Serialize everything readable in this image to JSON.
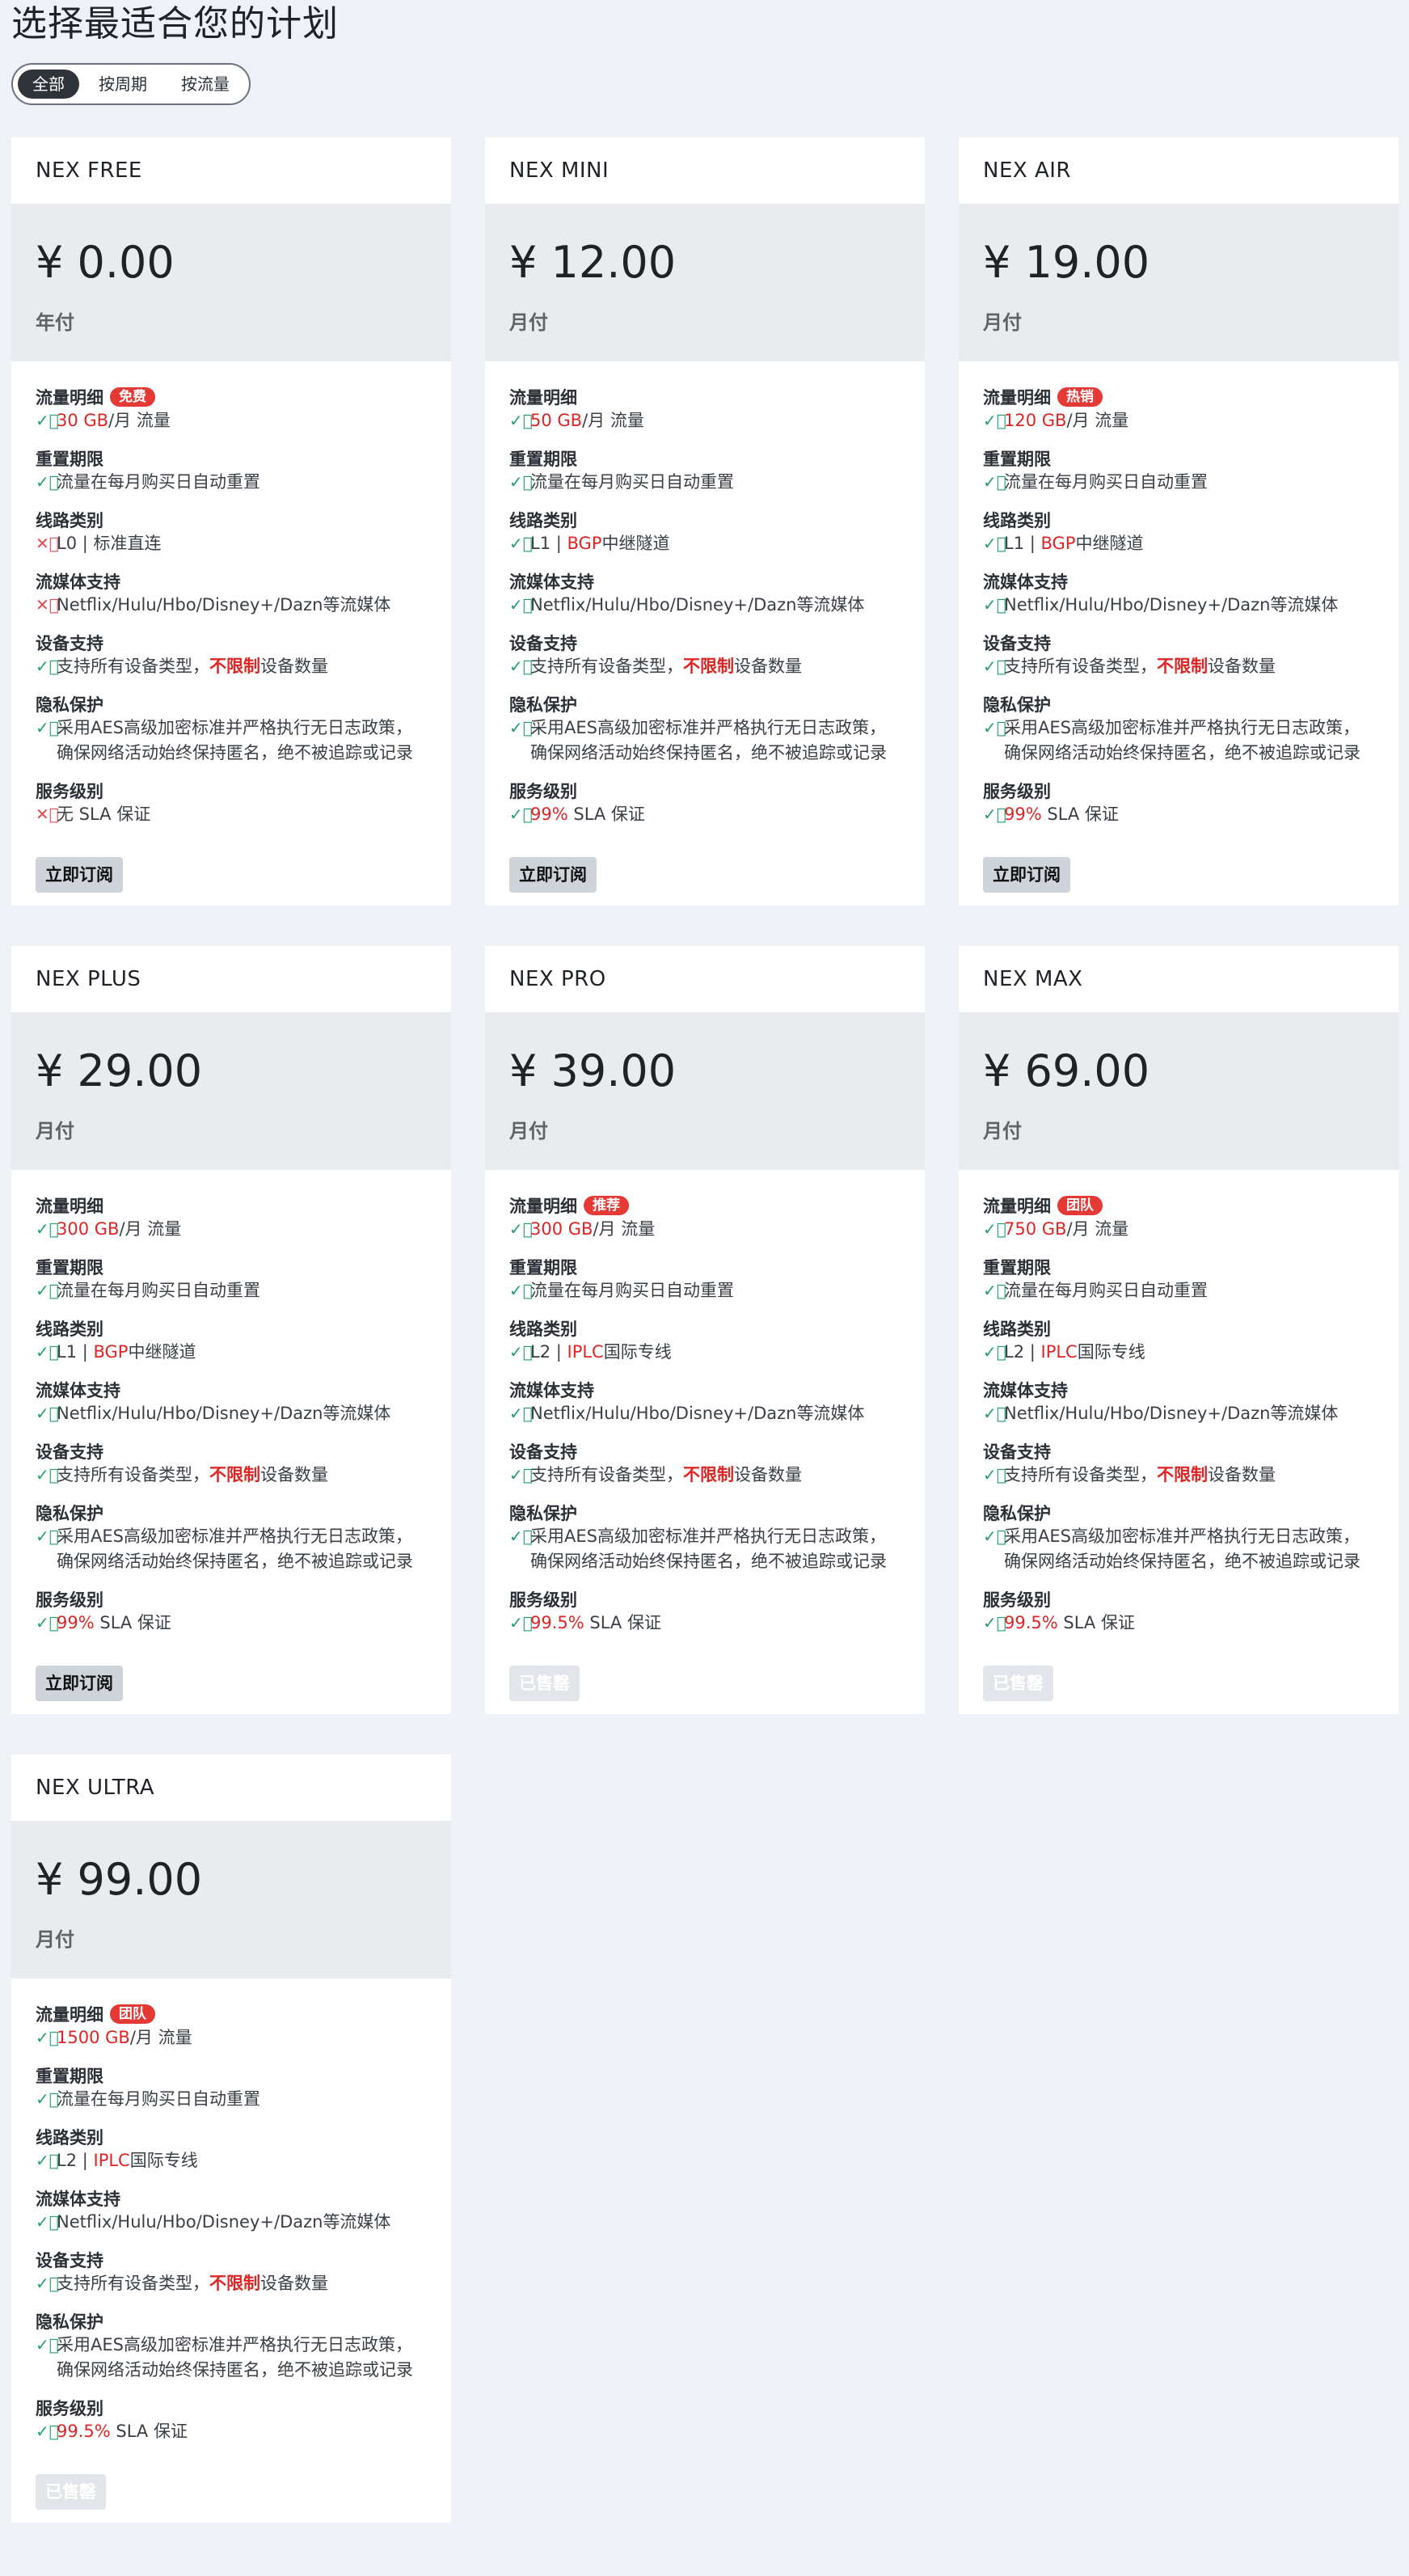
{
  "page": {
    "title": "选择最适合您的计划",
    "filters": [
      {
        "label": "全部",
        "active": true
      },
      {
        "label": "按周期",
        "active": false
      },
      {
        "label": "按流量",
        "active": false
      }
    ]
  },
  "labels": {
    "traffic": "流量明细",
    "reset": "重置期限",
    "route": "线路类别",
    "stream": "流媒体支持",
    "device": "设备支持",
    "privacy": "隐私保护",
    "sla": "服务级别"
  },
  "plans": [
    {
      "name": "NEX FREE",
      "price": "¥ 0.00",
      "cycle": "年付",
      "badge": "免费",
      "traffic_value": "30 GB",
      "traffic_suffix": "/月 流量",
      "reset": "流量在每月购买日自动重置",
      "route_prefix": "L0 | ",
      "route_hl": "",
      "route_suffix": "标准直连",
      "route_ok": false,
      "stream": "Netflix/Hulu/Hbo/Disney+/Dazn等流媒体",
      "stream_ok": false,
      "device_a": "支持所有设备类型，",
      "device_b": "不限制",
      "device_c": "设备数量",
      "privacy": "采用AES高级加密标准并严格执行无日志政策，确保网络活动始终保持匿名，绝不被追踪或记录",
      "sla_value": "",
      "sla_suffix": "无 SLA 保证",
      "sla_ok": false,
      "button": "立即订阅",
      "sold": false
    },
    {
      "name": "NEX MINI",
      "price": "¥ 12.00",
      "cycle": "月付",
      "badge": "",
      "traffic_value": "50 GB",
      "traffic_suffix": "/月 流量",
      "reset": "流量在每月购买日自动重置",
      "route_prefix": "L1 | ",
      "route_hl": "BGP",
      "route_suffix": "中继隧道",
      "route_ok": true,
      "stream": "Netflix/Hulu/Hbo/Disney+/Dazn等流媒体",
      "stream_ok": true,
      "device_a": "支持所有设备类型，",
      "device_b": "不限制",
      "device_c": "设备数量",
      "privacy": "采用AES高级加密标准并严格执行无日志政策，确保网络活动始终保持匿名，绝不被追踪或记录",
      "sla_value": "99%",
      "sla_suffix": " SLA 保证",
      "sla_ok": true,
      "button": "立即订阅",
      "sold": false
    },
    {
      "name": "NEX AIR",
      "price": "¥ 19.00",
      "cycle": "月付",
      "badge": "热销",
      "traffic_value": "120 GB",
      "traffic_suffix": "/月 流量",
      "reset": "流量在每月购买日自动重置",
      "route_prefix": "L1 | ",
      "route_hl": "BGP",
      "route_suffix": "中继隧道",
      "route_ok": true,
      "stream": "Netflix/Hulu/Hbo/Disney+/Dazn等流媒体",
      "stream_ok": true,
      "device_a": "支持所有设备类型，",
      "device_b": "不限制",
      "device_c": "设备数量",
      "privacy": "采用AES高级加密标准并严格执行无日志政策，确保网络活动始终保持匿名，绝不被追踪或记录",
      "sla_value": "99%",
      "sla_suffix": " SLA 保证",
      "sla_ok": true,
      "button": "立即订阅",
      "sold": false
    },
    {
      "name": "NEX PLUS",
      "price": "¥ 29.00",
      "cycle": "月付",
      "badge": "",
      "traffic_value": "300 GB",
      "traffic_suffix": "/月 流量",
      "reset": "流量在每月购买日自动重置",
      "route_prefix": "L1 | ",
      "route_hl": "BGP",
      "route_suffix": "中继隧道",
      "route_ok": true,
      "stream": "Netflix/Hulu/Hbo/Disney+/Dazn等流媒体",
      "stream_ok": true,
      "device_a": "支持所有设备类型，",
      "device_b": "不限制",
      "device_c": "设备数量",
      "privacy": "采用AES高级加密标准并严格执行无日志政策，确保网络活动始终保持匿名，绝不被追踪或记录",
      "sla_value": "99%",
      "sla_suffix": " SLA 保证",
      "sla_ok": true,
      "button": "立即订阅",
      "sold": false
    },
    {
      "name": "NEX PRO",
      "price": "¥ 39.00",
      "cycle": "月付",
      "badge": "推荐",
      "traffic_value": "300 GB",
      "traffic_suffix": "/月 流量",
      "reset": "流量在每月购买日自动重置",
      "route_prefix": "L2 | ",
      "route_hl": "IPLC",
      "route_suffix": "国际专线",
      "route_ok": true,
      "stream": "Netflix/Hulu/Hbo/Disney+/Dazn等流媒体",
      "stream_ok": true,
      "device_a": "支持所有设备类型，",
      "device_b": "不限制",
      "device_c": "设备数量",
      "privacy": "采用AES高级加密标准并严格执行无日志政策，确保网络活动始终保持匿名，绝不被追踪或记录",
      "sla_value": "99.5%",
      "sla_suffix": " SLA 保证",
      "sla_ok": true,
      "button": "已售罄",
      "sold": true
    },
    {
      "name": "NEX MAX",
      "price": "¥ 69.00",
      "cycle": "月付",
      "badge": "团队",
      "traffic_value": "750 GB",
      "traffic_suffix": "/月 流量",
      "reset": "流量在每月购买日自动重置",
      "route_prefix": "L2 | ",
      "route_hl": "IPLC",
      "route_suffix": "国际专线",
      "route_ok": true,
      "stream": "Netflix/Hulu/Hbo/Disney+/Dazn等流媒体",
      "stream_ok": true,
      "device_a": "支持所有设备类型，",
      "device_b": "不限制",
      "device_c": "设备数量",
      "privacy": "采用AES高级加密标准并严格执行无日志政策，确保网络活动始终保持匿名，绝不被追踪或记录",
      "sla_value": "99.5%",
      "sla_suffix": " SLA 保证",
      "sla_ok": true,
      "button": "已售罄",
      "sold": true
    },
    {
      "name": "NEX ULTRA",
      "price": "¥ 99.00",
      "cycle": "月付",
      "badge": "团队",
      "traffic_value": "1500 GB",
      "traffic_suffix": "/月 流量",
      "reset": "流量在每月购买日自动重置",
      "route_prefix": "L2 | ",
      "route_hl": "IPLC",
      "route_suffix": "国际专线",
      "route_ok": true,
      "stream": "Netflix/Hulu/Hbo/Disney+/Dazn等流媒体",
      "stream_ok": true,
      "device_a": "支持所有设备类型，",
      "device_b": "不限制",
      "device_c": "设备数量",
      "privacy": "采用AES高级加密标准并严格执行无日志政策，确保网络活动始终保持匿名，绝不被追踪或记录",
      "sla_value": "99.5%",
      "sla_suffix": " SLA 保证",
      "sla_ok": true,
      "button": "已售罄",
      "sold": true
    }
  ],
  "icons": {
    "check": "check-circle-icon",
    "cross": "x-circle-icon"
  },
  "colors": {
    "accent": "#e02424",
    "check": "#22a06b",
    "cross": "#e5484d",
    "badge": "#e53935"
  }
}
